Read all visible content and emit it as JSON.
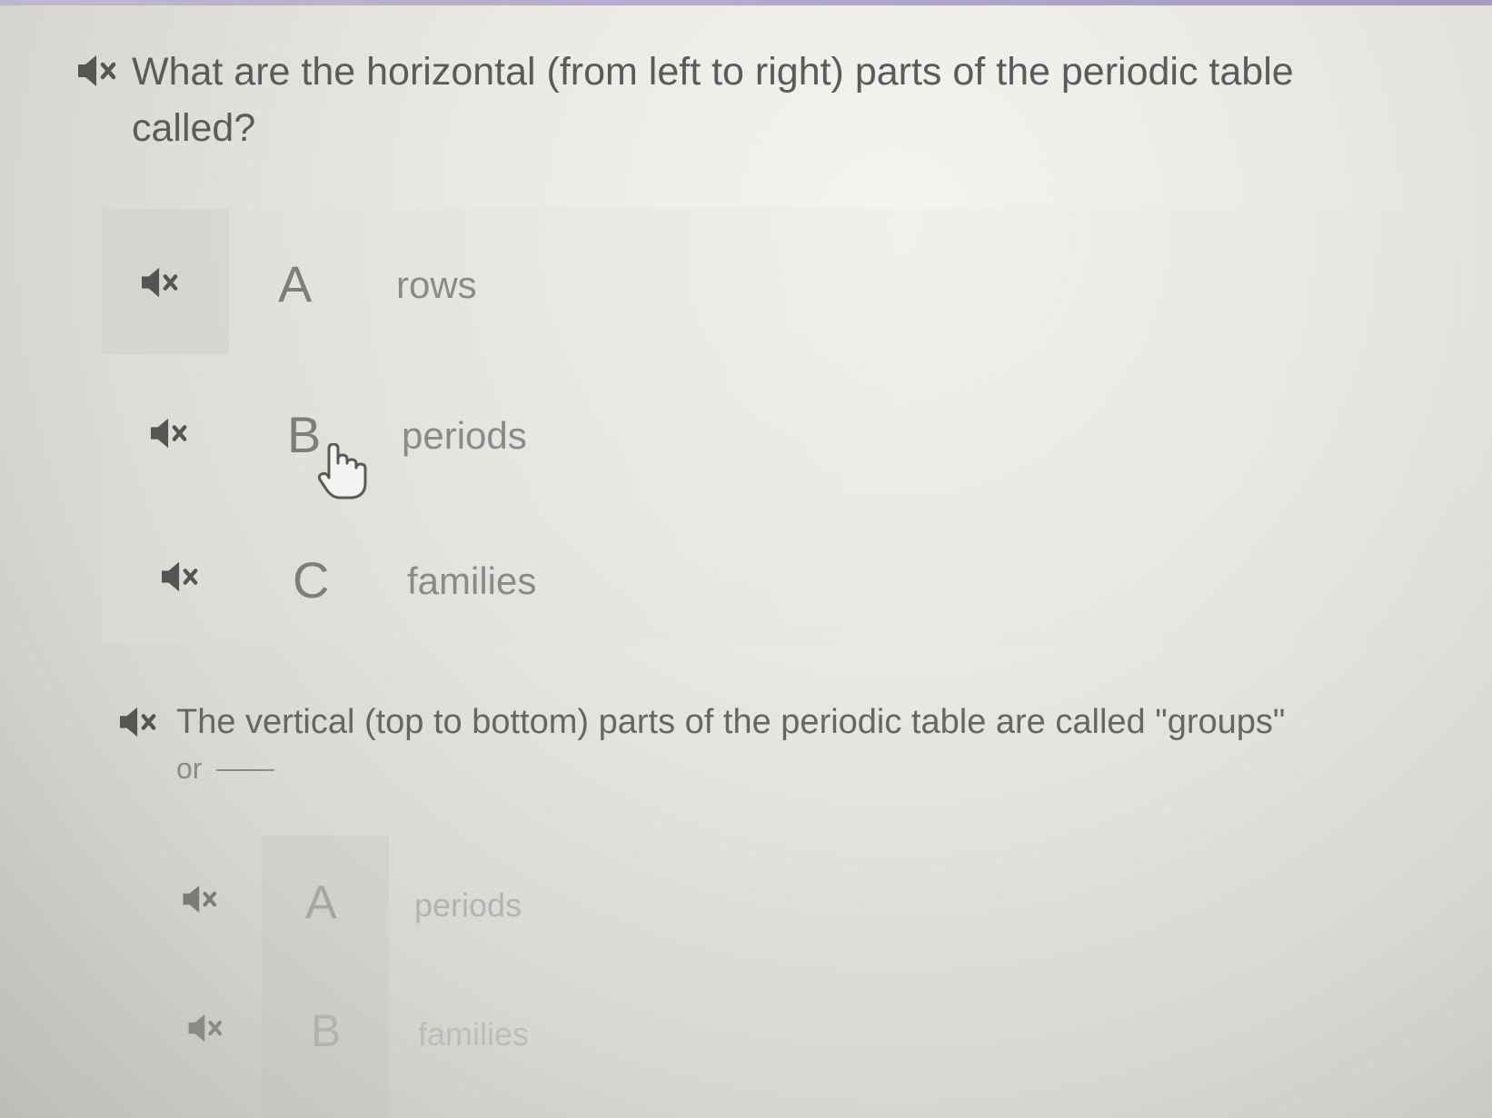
{
  "questions": [
    {
      "prompt_line1": "What are the horizontal (from left to right) parts of the periodic table",
      "prompt_line2": "called?",
      "options": [
        {
          "letter": "A",
          "text": "rows"
        },
        {
          "letter": "B",
          "text": "periods"
        },
        {
          "letter": "C",
          "text": "families"
        }
      ]
    },
    {
      "prompt_line1": "The vertical (top to bottom) parts of the periodic table are called \"groups\"",
      "prompt_line2": "or",
      "options": [
        {
          "letter": "A",
          "text": "periods"
        },
        {
          "letter": "B",
          "text": "families"
        }
      ]
    }
  ],
  "icons": {
    "audio": "speaker-mute-icon",
    "cursor": "hand-pointer-icon"
  },
  "colors": {
    "text": "#5b5b5b",
    "option_text": "#8a8a8a",
    "top_accent": "#9b8cc3"
  }
}
